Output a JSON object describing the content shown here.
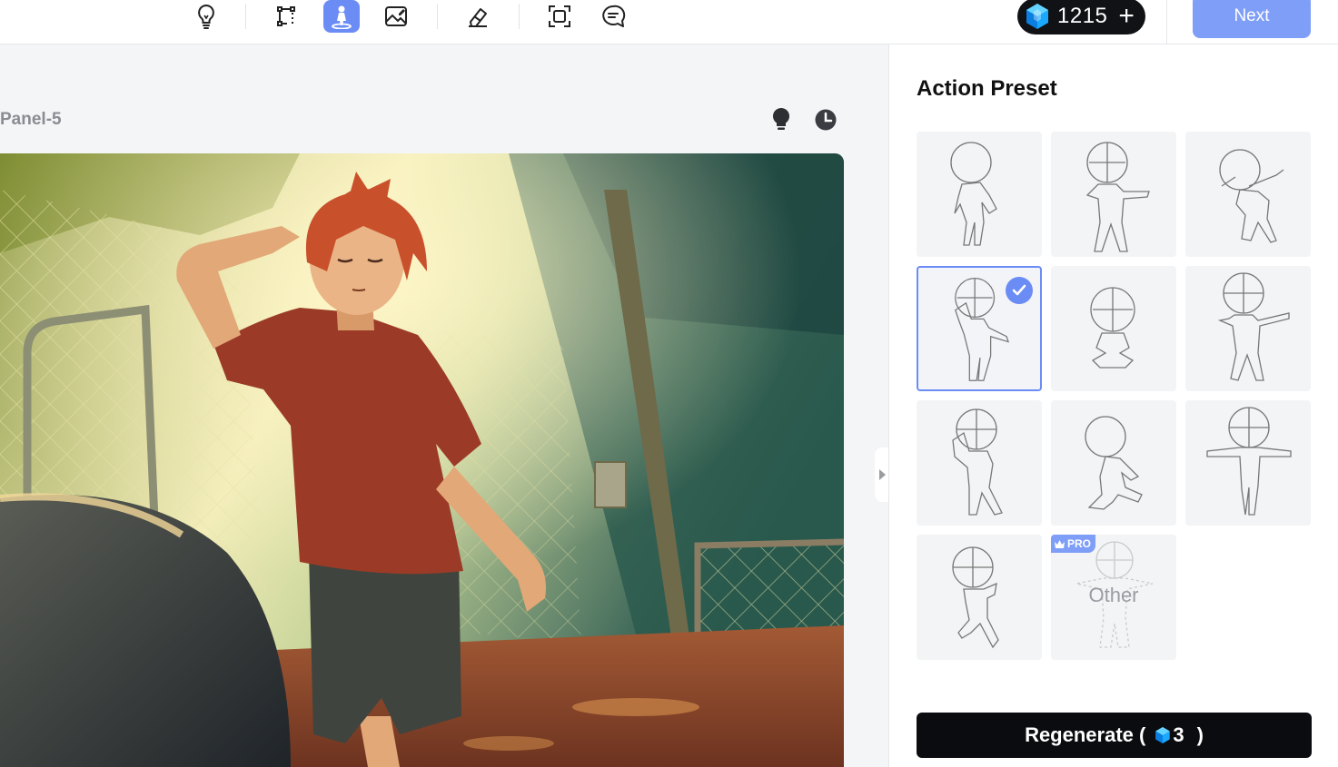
{
  "toolbar": {
    "tools": [
      {
        "icon": "lightbulb-icon"
      },
      {
        "icon": "layout-edit-icon"
      },
      {
        "icon": "pose-figure-icon",
        "active": true
      },
      {
        "icon": "image-edit-icon"
      },
      {
        "icon": "eraser-icon"
      },
      {
        "icon": "crop-frame-icon"
      },
      {
        "icon": "chat-bubble-icon"
      }
    ],
    "credits": "1215",
    "add_credits": "+",
    "next_label": "Next"
  },
  "workspace": {
    "panel_label": "Panel-5",
    "hint_icon": "lightbulb-icon",
    "history_icon": "clock-icon"
  },
  "sidebar": {
    "title": "Action Preset",
    "presets": [
      {
        "pose": "pose-1"
      },
      {
        "pose": "pose-2"
      },
      {
        "pose": "pose-3"
      },
      {
        "pose": "pose-4",
        "selected": true
      },
      {
        "pose": "pose-5"
      },
      {
        "pose": "pose-6"
      },
      {
        "pose": "pose-7"
      },
      {
        "pose": "pose-8"
      },
      {
        "pose": "pose-9"
      },
      {
        "pose": "pose-10"
      }
    ],
    "other": {
      "badge": "PRO",
      "label": "Other"
    },
    "regenerate": {
      "label": "Regenerate (",
      "cost": "3",
      "close": ")"
    }
  },
  "colors": {
    "accent": "#6c8cf5",
    "next_button": "#7f9ef7",
    "dark": "#0b0c0f",
    "shirt": "#9b3b27"
  }
}
